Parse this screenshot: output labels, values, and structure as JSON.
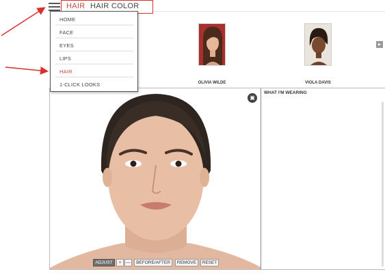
{
  "tabs": [
    {
      "label": "HAIR",
      "active": true
    },
    {
      "label": "HAIR COLOR",
      "active": false
    }
  ],
  "menu": {
    "items": [
      {
        "label": "HOME"
      },
      {
        "label": "FACE"
      },
      {
        "label": "EYES"
      },
      {
        "label": "LIPS"
      },
      {
        "label": "HAIR",
        "active": true
      },
      {
        "label": "1-CLICK LOOKS"
      }
    ]
  },
  "gallery": {
    "stars": [
      {
        "name": "OLIVIA WILDE"
      },
      {
        "name": "VIOLA DAVIS"
      }
    ]
  },
  "wearing": {
    "title": "WHAT I'M WEARING"
  },
  "controls": {
    "adjust": "ADJUST",
    "zoom_in": "+",
    "zoom_out": "—",
    "before_after": "BEFORE/AFTER",
    "remove": "REMOVE",
    "reset": "RESET"
  },
  "colors": {
    "accent": "#c8473f",
    "annotation": "#d9302c"
  },
  "icons": [
    "hamburger-icon",
    "camera-icon",
    "chevron-right-icon",
    "arrow-annotation"
  ]
}
